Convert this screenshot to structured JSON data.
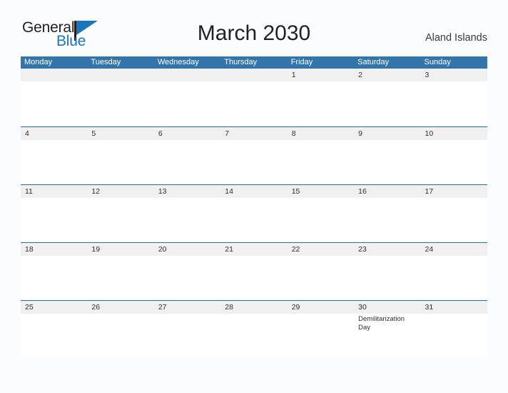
{
  "brand": {
    "name_part1": "General",
    "name_part2": "Blue",
    "flag_icon": "blue-triangle-flag-icon"
  },
  "header": {
    "title": "March 2030",
    "locale": "Aland Islands"
  },
  "calendar": {
    "weekdays": [
      "Monday",
      "Tuesday",
      "Wednesday",
      "Thursday",
      "Friday",
      "Saturday",
      "Sunday"
    ],
    "colors": {
      "header_blue": "#3375ab",
      "row_divider_blue": "#2f6d9e",
      "date_band_gray": "#f0f0f0",
      "page_background": "#fbfcfd",
      "brand_blue": "#1b75bc"
    },
    "weeks": [
      {
        "days": [
          {
            "num": "",
            "events": []
          },
          {
            "num": "",
            "events": []
          },
          {
            "num": "",
            "events": []
          },
          {
            "num": "",
            "events": []
          },
          {
            "num": "1",
            "events": []
          },
          {
            "num": "2",
            "events": []
          },
          {
            "num": "3",
            "events": []
          }
        ]
      },
      {
        "days": [
          {
            "num": "4",
            "events": []
          },
          {
            "num": "5",
            "events": []
          },
          {
            "num": "6",
            "events": []
          },
          {
            "num": "7",
            "events": []
          },
          {
            "num": "8",
            "events": []
          },
          {
            "num": "9",
            "events": []
          },
          {
            "num": "10",
            "events": []
          }
        ]
      },
      {
        "days": [
          {
            "num": "11",
            "events": []
          },
          {
            "num": "12",
            "events": []
          },
          {
            "num": "13",
            "events": []
          },
          {
            "num": "14",
            "events": []
          },
          {
            "num": "15",
            "events": []
          },
          {
            "num": "16",
            "events": []
          },
          {
            "num": "17",
            "events": []
          }
        ]
      },
      {
        "days": [
          {
            "num": "18",
            "events": []
          },
          {
            "num": "19",
            "events": []
          },
          {
            "num": "20",
            "events": []
          },
          {
            "num": "21",
            "events": []
          },
          {
            "num": "22",
            "events": []
          },
          {
            "num": "23",
            "events": []
          },
          {
            "num": "24",
            "events": []
          }
        ]
      },
      {
        "days": [
          {
            "num": "25",
            "events": []
          },
          {
            "num": "26",
            "events": []
          },
          {
            "num": "27",
            "events": []
          },
          {
            "num": "28",
            "events": []
          },
          {
            "num": "29",
            "events": []
          },
          {
            "num": "30",
            "events": [
              "Demilitarization Day"
            ]
          },
          {
            "num": "31",
            "events": []
          }
        ]
      }
    ]
  }
}
